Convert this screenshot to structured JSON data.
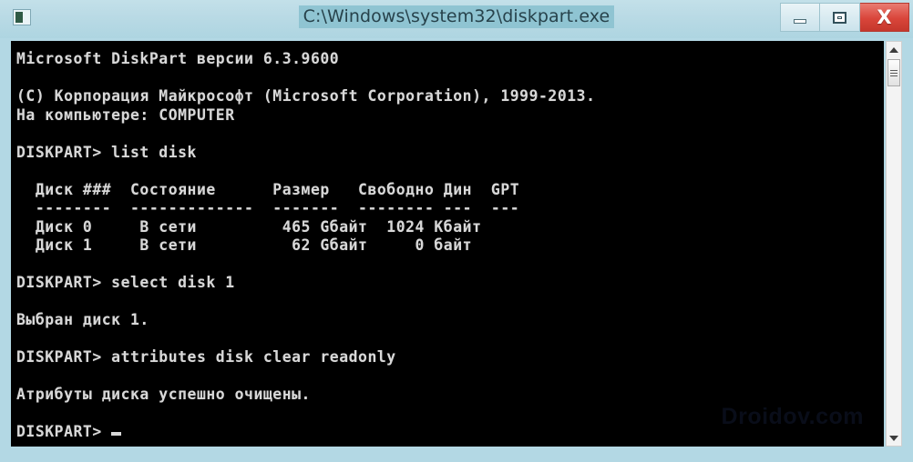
{
  "window": {
    "title": "C:\\Windows\\system32\\diskpart.exe",
    "icon": "console-icon",
    "accent_border": "#b3d8e4",
    "titlebar_color": "#b9dae5",
    "title_highlight": "#8fc4d2",
    "console_bg": "#000000",
    "console_fg": "#d8d8d8",
    "close_color": "#d9453a"
  },
  "buttons": {
    "minimize": "–",
    "maximize": "□",
    "close": "X"
  },
  "console": {
    "lines": [
      "Microsoft DiskPart версии 6.3.9600",
      "",
      "(C) Корпорация Майкрософт (Microsoft Corporation), 1999-2013.",
      "На компьютере: COMPUTER",
      "",
      "DISKPART> list disk",
      "",
      "  Диск ###  Состояние      Размер   Свободно Дин  GPT",
      "  --------  -------------  -------  -------- ---  ---",
      "  Диск 0     В сети         465 Gбайт  1024 Кбайт",
      "  Диск 1     В сети          62 Gбайт     0 байт",
      "",
      "DISKPART> select disk 1",
      "",
      "Выбран диск 1.",
      "",
      "DISKPART> attributes disk clear readonly",
      "",
      "Атрибуты диска успешно очищены.",
      "",
      "DISKPART> "
    ],
    "prompt": "DISKPART>",
    "commands": [
      "list disk",
      "select disk 1",
      "attributes disk clear readonly"
    ],
    "header_line": "Microsoft DiskPart версии 6.3.9600",
    "copyright": "(C) Корпорация Майкрософт (Microsoft Corporation), 1999-2013.",
    "computer_line": "На компьютере: COMPUTER",
    "select_result": "Выбран диск 1.",
    "attributes_result": "Атрибуты диска успешно очищены.",
    "disk_table": {
      "columns": [
        "Диск ###",
        "Состояние",
        "Размер",
        "Свободно",
        "Дин",
        "GPT"
      ],
      "rows": [
        [
          "Диск 0",
          "В сети",
          "465 Gбайт",
          "1024 Кбайт",
          "",
          ""
        ],
        [
          "Диск 1",
          "В сети",
          "62 Gбайт",
          "0 байт",
          "",
          ""
        ]
      ]
    }
  },
  "watermark": {
    "text": "Droidov.com"
  },
  "scrollbar": {
    "up_arrow": "▲",
    "down_arrow": "▼"
  }
}
